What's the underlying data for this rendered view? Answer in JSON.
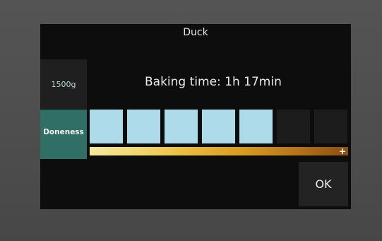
{
  "title": "Duck",
  "weight": "1500g",
  "baking_time": "Baking time:  1h 17min",
  "doneness": {
    "label": "Doneness",
    "level": 5,
    "max": 7
  },
  "slider": {
    "plus": "+"
  },
  "ok_label": "OK",
  "colors": {
    "active_tab": "#2f6f66",
    "segment_on": "#aedbea",
    "segment_off": "#1c1c1c"
  }
}
